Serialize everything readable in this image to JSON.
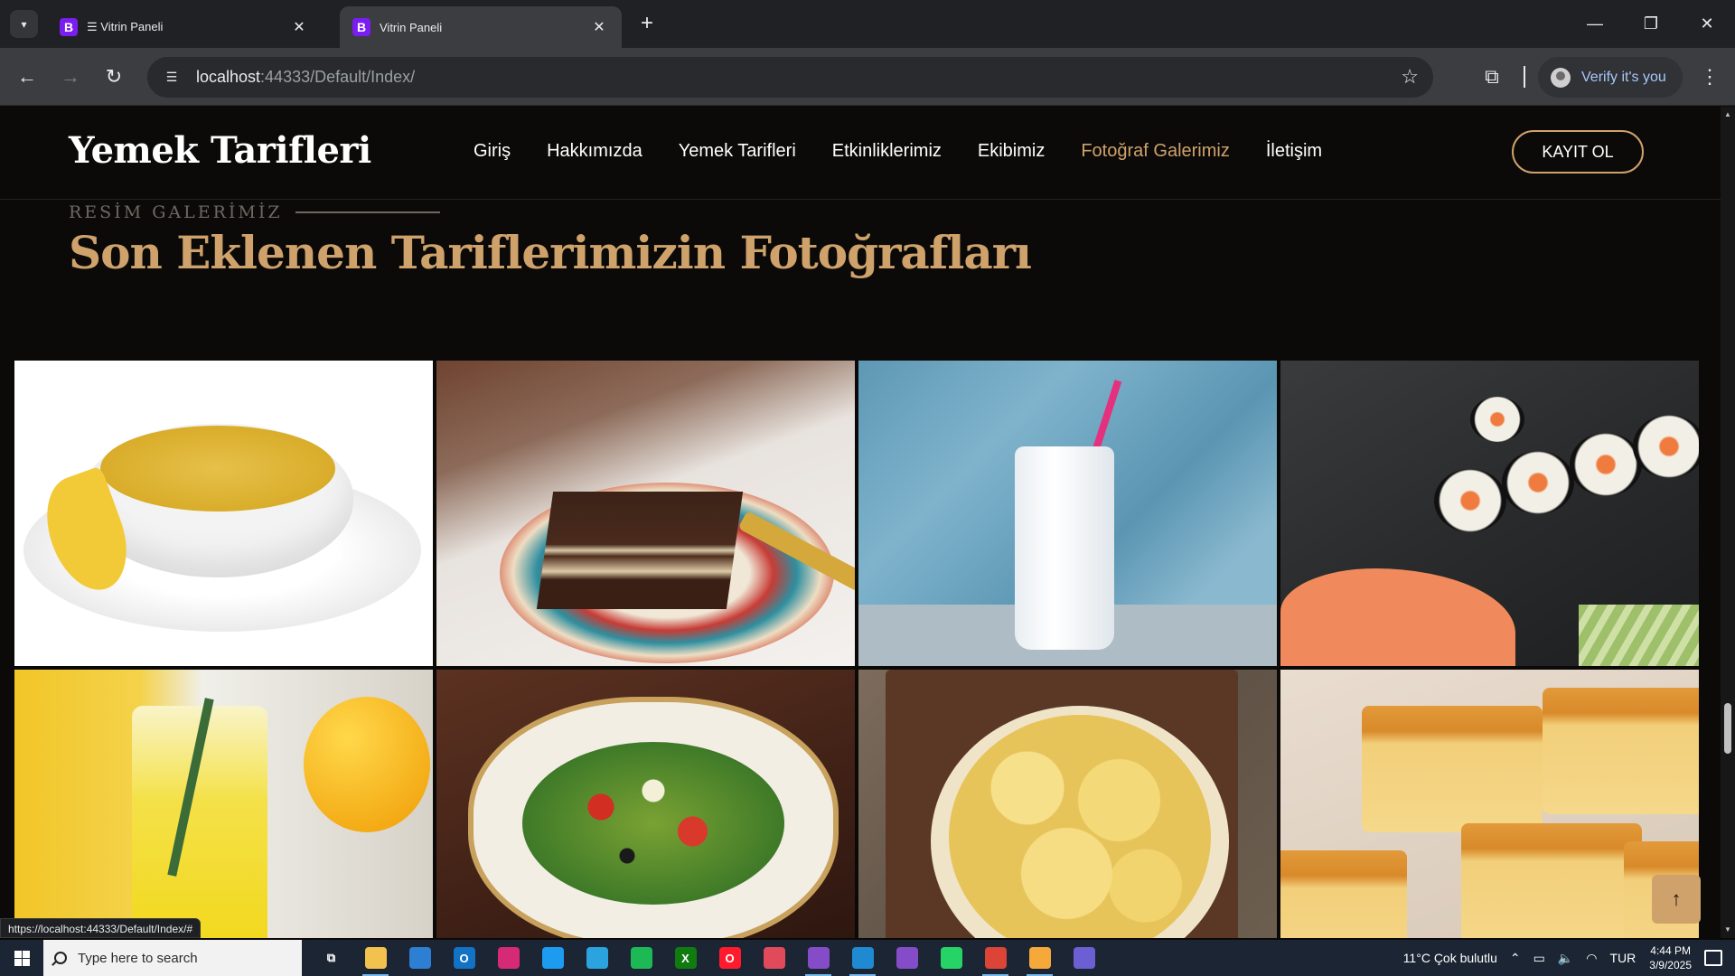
{
  "browser": {
    "tabs": [
      {
        "title": "☰ Vitrin Paneli",
        "favicon": "B",
        "active": false
      },
      {
        "title": "Vitrin Paneli",
        "favicon": "B",
        "active": true
      }
    ],
    "url_host": "localhost",
    "url_rest": ":44333/Default/Index/",
    "profile_label": "Verify it's you",
    "status_url": "https://localhost:44333/Default/Index/#"
  },
  "site": {
    "brand": "Yemek Tarifleri",
    "nav": [
      {
        "label": "Giriş",
        "active": false
      },
      {
        "label": "Hakkımızda",
        "active": false
      },
      {
        "label": "Yemek Tarifleri",
        "active": false
      },
      {
        "label": "Etkinliklerimiz",
        "active": false
      },
      {
        "label": "Ekibimiz",
        "active": false
      },
      {
        "label": "Fotoğraf Galerimiz",
        "active": true
      },
      {
        "label": "İletişim",
        "active": false
      }
    ],
    "register_label": "KAYIT OL",
    "accent": "#cfa26b"
  },
  "gallery": {
    "eyebrow": "RESİM GALERİMİZ",
    "heading": "Son Eklenen Tariflerimizin Fotoğrafları",
    "photos": [
      "soup",
      "chocolate-cake",
      "ayran",
      "sushi",
      "lemonade",
      "salad",
      "potato-chips",
      "revani"
    ]
  },
  "taskbar": {
    "search_placeholder": "Type here to search",
    "weather": "11°C  Çok bulutlu",
    "language": "TUR",
    "time": "4:44 PM",
    "date": "3/9/2025",
    "apps": [
      {
        "name": "task-view",
        "color": "#1c2533",
        "glyph": "⧉"
      },
      {
        "name": "file-explorer",
        "color": "#f2c14e",
        "glyph": ""
      },
      {
        "name": "microsoft-store",
        "color": "#2d7fd3",
        "glyph": ""
      },
      {
        "name": "outlook",
        "color": "#1272c4",
        "glyph": "O"
      },
      {
        "name": "instagram",
        "color": "#d62976",
        "glyph": ""
      },
      {
        "name": "twitter",
        "color": "#1d9bf0",
        "glyph": ""
      },
      {
        "name": "telegram",
        "color": "#2aa3df",
        "glyph": ""
      },
      {
        "name": "spotify",
        "color": "#1db954",
        "glyph": ""
      },
      {
        "name": "xbox",
        "color": "#107c10",
        "glyph": "X"
      },
      {
        "name": "opera",
        "color": "#ff1b2d",
        "glyph": "O"
      },
      {
        "name": "snipping-tool",
        "color": "#e04a5b",
        "glyph": ""
      },
      {
        "name": "visual-studio",
        "color": "#854cc7",
        "glyph": ""
      },
      {
        "name": "vs-code",
        "color": "#1f8ad2",
        "glyph": ""
      },
      {
        "name": "visual-studio-2",
        "color": "#854cc7",
        "glyph": ""
      },
      {
        "name": "whatsapp",
        "color": "#25d366",
        "glyph": ""
      },
      {
        "name": "chrome",
        "color": "#db4437",
        "glyph": ""
      },
      {
        "name": "paint",
        "color": "#f6a93b",
        "glyph": ""
      },
      {
        "name": "app-swirl",
        "color": "#6b5fd3",
        "glyph": ""
      }
    ]
  }
}
